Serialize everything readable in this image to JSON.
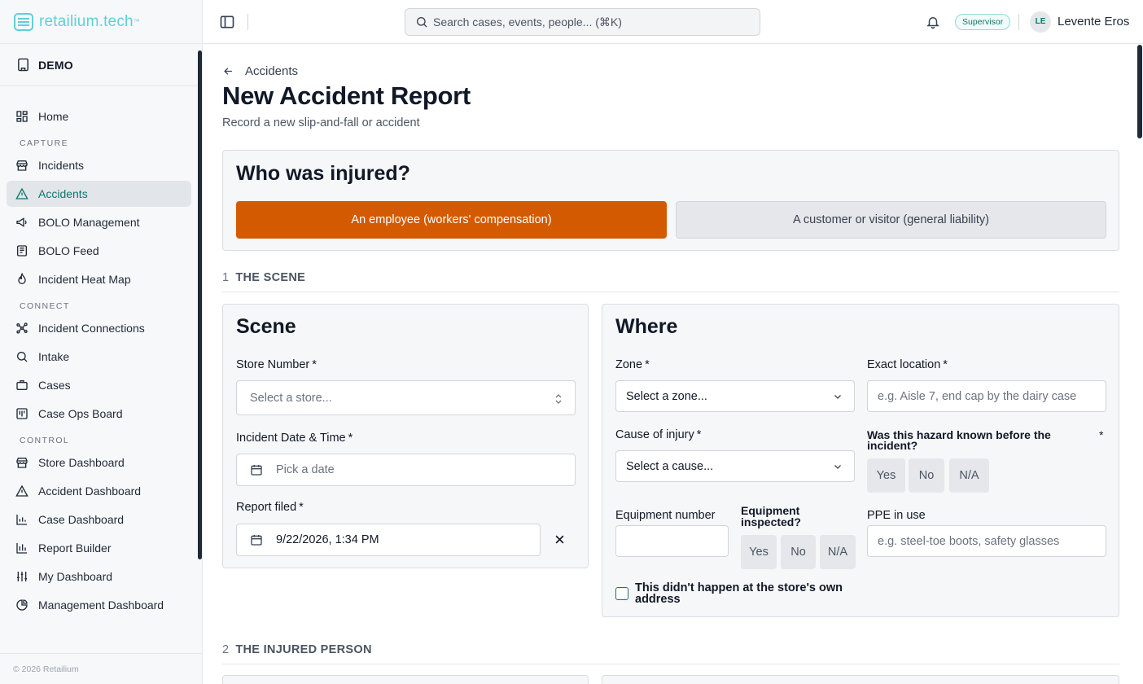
{
  "brand": {
    "name": "retailium.tech",
    "tm": "™"
  },
  "org": {
    "name": "DEMO"
  },
  "sidebar": {
    "home": "Home",
    "capture_title": "CAPTURE",
    "incidents": "Incidents",
    "accidents": "Accidents",
    "bolo_management": "BOLO Management",
    "bolo_feed": "BOLO Feed",
    "heat_map": "Incident Heat Map",
    "connect_title": "CONNECT",
    "incident_connections": "Incident Connections",
    "intake": "Intake",
    "cases": "Cases",
    "case_ops": "Case Ops Board",
    "control_title": "CONTROL",
    "store_dashboard": "Store Dashboard",
    "accident_dashboard": "Accident Dashboard",
    "case_dashboard": "Case Dashboard",
    "report_builder": "Report Builder",
    "my_dashboard": "My Dashboard",
    "management_dashboard": "Management Dashboard",
    "footer": "© 2026 Retailium"
  },
  "topbar": {
    "search_placeholder": "Search cases, events, people... (⌘K)",
    "role": "Supervisor",
    "avatar_initials": "LE",
    "user_name": "Levente Eros"
  },
  "page": {
    "back_label": "Accidents",
    "title": "New Accident Report",
    "subtitle": "Record a new slip-and-fall or accident"
  },
  "who": {
    "title": "Who was injured?",
    "employee": "An employee (workers' compensation)",
    "customer": "A customer or visitor (general liability)"
  },
  "section1": {
    "num": "1",
    "title": "THE SCENE"
  },
  "section2": {
    "num": "2",
    "title": "THE INJURED PERSON"
  },
  "scene": {
    "title": "Scene",
    "store_label": "Store Number",
    "store_placeholder": "Select a store...",
    "datetime_label": "Incident Date & Time",
    "datetime_placeholder": "Pick a date",
    "filed_label": "Report filed",
    "filed_value": "9/22/2026, 1:34 PM"
  },
  "where": {
    "title": "Where",
    "zone_label": "Zone",
    "zone_placeholder": "Select a zone...",
    "exact_label": "Exact location",
    "exact_placeholder": "e.g. Aisle 7, end cap by the dairy case",
    "cause_label": "Cause of injury",
    "cause_placeholder": "Select a cause...",
    "hazard_label_1": "Was this hazard known before the",
    "hazard_label_2": "incident?",
    "yes": "Yes",
    "no": "No",
    "na": "N/A",
    "equip_num_label": "Equipment number",
    "equip_insp_label_1": "Equipment",
    "equip_insp_label_2": "inspected?",
    "ppe_label": "PPE in use",
    "ppe_placeholder": "e.g. steel-toe boots, safety glasses",
    "offsite_label_1": "This didn't happen at the store's own",
    "offsite_label_2": "address"
  },
  "required_mark": "*",
  "colors": {
    "accent": "#0f766e",
    "brand": "#5fd0d6",
    "primary_choice": "#d45a00"
  }
}
